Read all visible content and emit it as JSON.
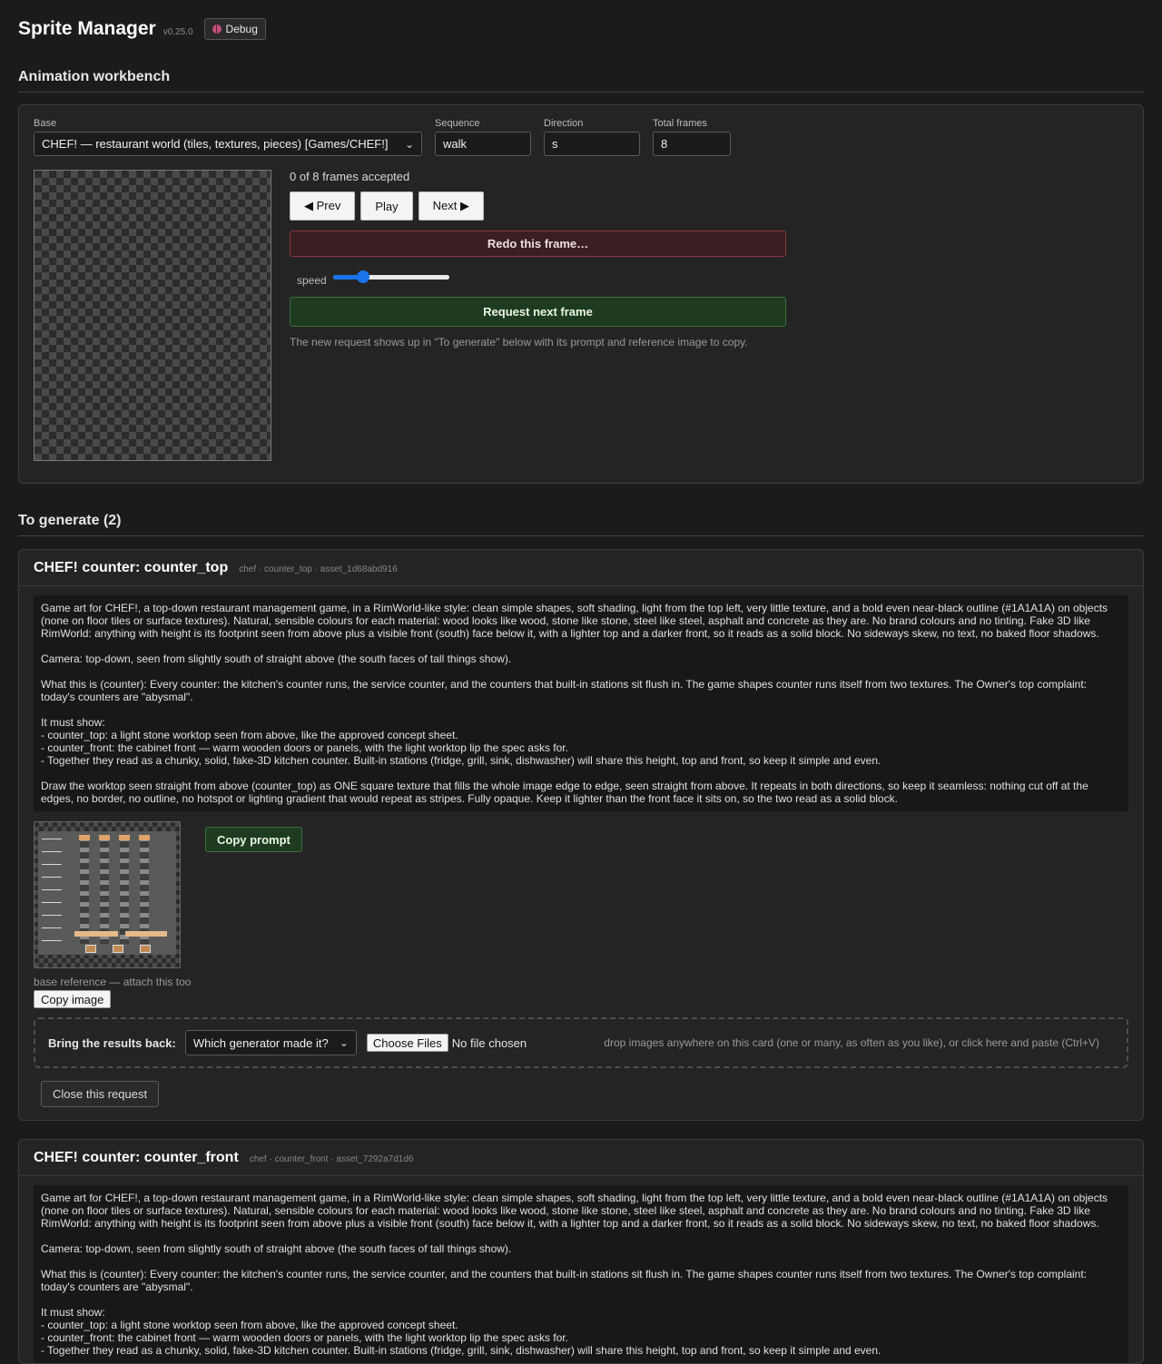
{
  "app": {
    "title": "Sprite Manager",
    "version": "v0.25.0",
    "debug_label": "Debug"
  },
  "workbench": {
    "section_title": "Animation workbench",
    "base_label": "Base",
    "base_value": "CHEF! — restaurant world (tiles, textures, pieces) [Games/CHEF!]",
    "sequence_label": "Sequence",
    "sequence_value": "walk",
    "direction_label": "Direction",
    "direction_value": "s",
    "total_frames_label": "Total frames",
    "total_frames_value": "8",
    "frames_status": "0 of 8 frames accepted",
    "prev_label": "◀ Prev",
    "play_label": "Play",
    "next_label": "Next ▶",
    "redo_label": "Redo this frame…",
    "speed_label": "speed",
    "speed_fraction": 0.26,
    "request_label": "Request next frame",
    "hint": "The new request shows up in \"To generate\" below with its prompt and reference image to copy."
  },
  "to_generate": {
    "section_title": "To generate (2)",
    "requests": [
      {
        "title": "CHEF! counter: counter_top",
        "meta": "chef · counter_top · asset_1d68abd916",
        "prompt": "Game art for CHEF!, a top-down restaurant management game, in a RimWorld-like style: clean simple shapes, soft shading, light from the top left, very little texture, and a bold even near-black outline (#1A1A1A) on objects (none on floor tiles or surface textures). Natural, sensible colours for each material: wood looks like wood, stone like stone, steel like steel, asphalt and concrete as they are. No brand colours and no tinting. Fake 3D like RimWorld: anything with height is its footprint seen from above plus a visible front (south) face below it, with a lighter top and a darker front, so it reads as a solid block. No sideways skew, no text, no baked floor shadows.\n\nCamera: top-down, seen from slightly south of straight above (the south faces of tall things show).\n\nWhat this is (counter): Every counter: the kitchen's counter runs, the service counter, and the counters that built-in stations sit flush in. The game shapes counter runs itself from two textures. The Owner's top complaint: today's counters are \"abysmal\".\n\nIt must show:\n- counter_top: a light stone worktop seen from above, like the approved concept sheet.\n- counter_front: the cabinet front — warm wooden doors or panels, with the light worktop lip the spec asks for.\n- Together they read as a chunky, solid, fake-3D kitchen counter. Built-in stations (fridge, grill, sink, dishwasher) will share this height, top and front, so keep it simple and even.\n\nDraw the worktop seen straight from above (counter_top) as ONE square texture that fills the whole image edge to edge, seen straight from above. It repeats in both directions, so keep it seamless: nothing cut off at the edges, no border, no outline, no hotspot or lighting gradient that would repeat as stripes. Fully opaque. Keep it lighter than the front face it sits on, so the two read as a solid block.",
        "copy_prompt_label": "Copy prompt",
        "ref_caption": "base reference — attach this too",
        "copy_image_label": "Copy image",
        "bring_back_label": "Bring the results back:",
        "generator_select": "Which generator made it?",
        "choose_files_label": "Choose Files",
        "no_file_label": "No file chosen",
        "drop_hint": "drop images anywhere on this card (one or many, as often as you like), or click here and paste (Ctrl+V)",
        "close_label": "Close this request"
      },
      {
        "title": "CHEF! counter: counter_front",
        "meta": "chef · counter_front · asset_7292a7d1d6",
        "prompt": "Game art for CHEF!, a top-down restaurant management game, in a RimWorld-like style: clean simple shapes, soft shading, light from the top left, very little texture, and a bold even near-black outline (#1A1A1A) on objects (none on floor tiles or surface textures). Natural, sensible colours for each material: wood looks like wood, stone like stone, steel like steel, asphalt and concrete as they are. No brand colours and no tinting. Fake 3D like RimWorld: anything with height is its footprint seen from above plus a visible front (south) face below it, with a lighter top and a darker front, so it reads as a solid block. No sideways skew, no text, no baked floor shadows.\n\nCamera: top-down, seen from slightly south of straight above (the south faces of tall things show).\n\nWhat this is (counter): Every counter: the kitchen's counter runs, the service counter, and the counters that built-in stations sit flush in. The game shapes counter runs itself from two textures. The Owner's top complaint: today's counters are \"abysmal\".\n\nIt must show:\n- counter_top: a light stone worktop seen from above, like the approved concept sheet.\n- counter_front: the cabinet front — warm wooden doors or panels, with the light worktop lip the spec asks for.\n- Together they read as a chunky, solid, fake-3D kitchen counter. Built-in stations (fridge, grill, sink, dishwasher) will share this height, top and front, so keep it simple and even."
      }
    ]
  }
}
